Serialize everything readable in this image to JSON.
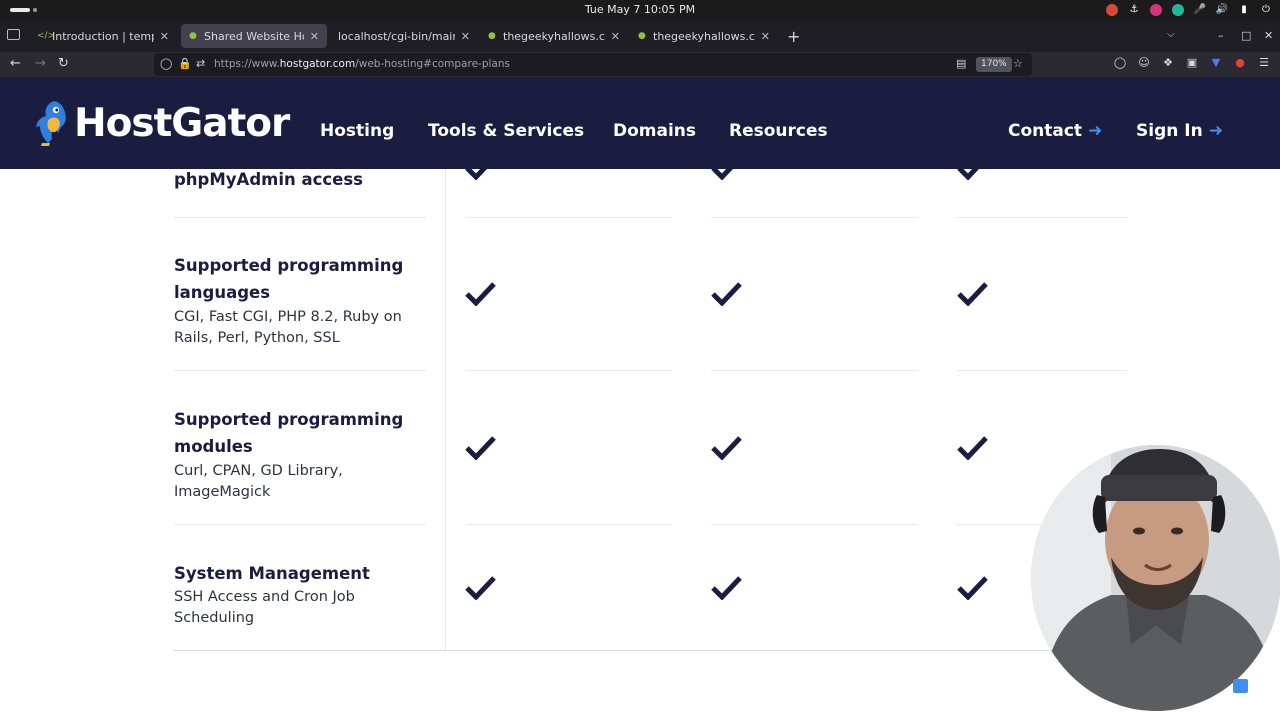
{
  "os": {
    "clock": "Tue May 7  10:05 PM",
    "tray_icons": [
      "ubuntu-icon",
      "docker-icon",
      "pink-app-icon",
      "chat-icon",
      "microphone-icon",
      "volume-icon",
      "battery-icon",
      "power-icon"
    ]
  },
  "browser": {
    "tabs": [
      {
        "title": "Introduction | templ docs",
        "favicon": "templ-icon",
        "active": false
      },
      {
        "title": "Shared Website Hosting",
        "favicon": "hostgator-icon",
        "active": true
      },
      {
        "title": "localhost/cgi-bin/main.fcgi",
        "favicon": "",
        "active": false
      },
      {
        "title": "thegeekyhallows.com/go",
        "favicon": "geeky-icon",
        "active": false
      },
      {
        "title": "thegeekyhallows.com/go",
        "favicon": "geeky-icon",
        "active": false
      }
    ],
    "url_prefix": "https://www.",
    "url_host": "hostgator.com",
    "url_path": "/web-hosting#compare-plans",
    "zoom": "170%"
  },
  "site": {
    "brand": "HostGator",
    "nav": [
      "Hosting",
      "Tools & Services",
      "Domains",
      "Resources"
    ],
    "contact": "Contact",
    "sign_in": "Sign In",
    "accent": "#3d8ef0",
    "header_bg": "#1b1d40"
  },
  "features": [
    {
      "title": "phpMyAdmin access",
      "description": "",
      "plans": [
        true,
        true,
        true
      ]
    },
    {
      "title": "Supported programming languages",
      "description": "CGI, Fast CGI, PHP 8.2, Ruby on Rails, Perl, Python, SSL",
      "plans": [
        true,
        true,
        true
      ]
    },
    {
      "title": "Supported programming modules",
      "description": "Curl, CPAN, GD Library, ImageMagick",
      "plans": [
        true,
        true,
        true
      ]
    },
    {
      "title": "System Management",
      "description": "SSH Access and Cron Job Scheduling",
      "plans": [
        true,
        true,
        true
      ]
    }
  ]
}
